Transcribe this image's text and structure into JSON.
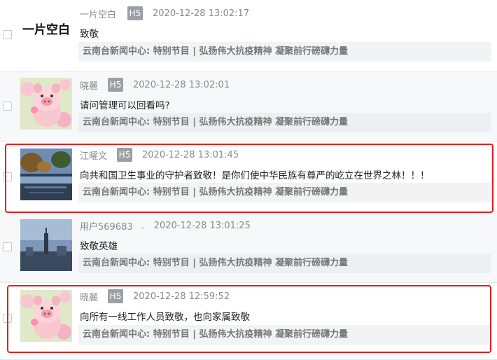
{
  "comments": [
    {
      "username": "一片空白",
      "badge": "H5",
      "timestamp": "2020-12-28 13:02:17",
      "content": "致敬",
      "source": "云南台新闻中心: 特别节目 | 弘扬伟大抗疫精神 凝聚前行磅礴力量",
      "avatar_text": "一片空白",
      "avatar": "calligraphy-avatar"
    },
    {
      "username": "晓麗",
      "badge": "H5",
      "timestamp": "2020-12-28 13:02:01",
      "content": "请问管理可以回看吗?",
      "source": "云南台新闻中心: 特别节目 | 弘扬伟大抗疫精神 凝聚前行磅礴力量",
      "avatar": "pig-avatar"
    },
    {
      "username": "江曜文",
      "badge": "H5",
      "timestamp": "2020-12-28 13:01:45",
      "content": "向共和国卫生事业的守护者致敬！是你们使中华民族有尊严的屹立在世界之林！！！",
      "source": "云南台新闻中心: 特别节目 | 弘扬伟大抗疫精神 凝聚前行磅礴力量",
      "avatar": "lake-avatar"
    },
    {
      "username": "用户569683",
      "badge": ".",
      "timestamp": "2020-12-28 13:01:25",
      "content": "致敬英雄",
      "source": "云南台新闻中心: 特别节目 | 弘扬伟大抗疫精神 凝聚前行磅礴力量",
      "avatar": "skyline-avatar"
    },
    {
      "username": "晓麗",
      "badge": "H5",
      "timestamp": "2020-12-28 12:59:52",
      "content": "向所有一线工作人员致敬，也向家属致敬",
      "source": "云南台新闻中心: 特别节目 | 弘扬伟大抗疫精神 凝聚前行磅礴力量",
      "avatar": "pig-avatar"
    }
  ],
  "colors": {
    "highlight": "#e02020",
    "badge": "#9aa0a6"
  }
}
